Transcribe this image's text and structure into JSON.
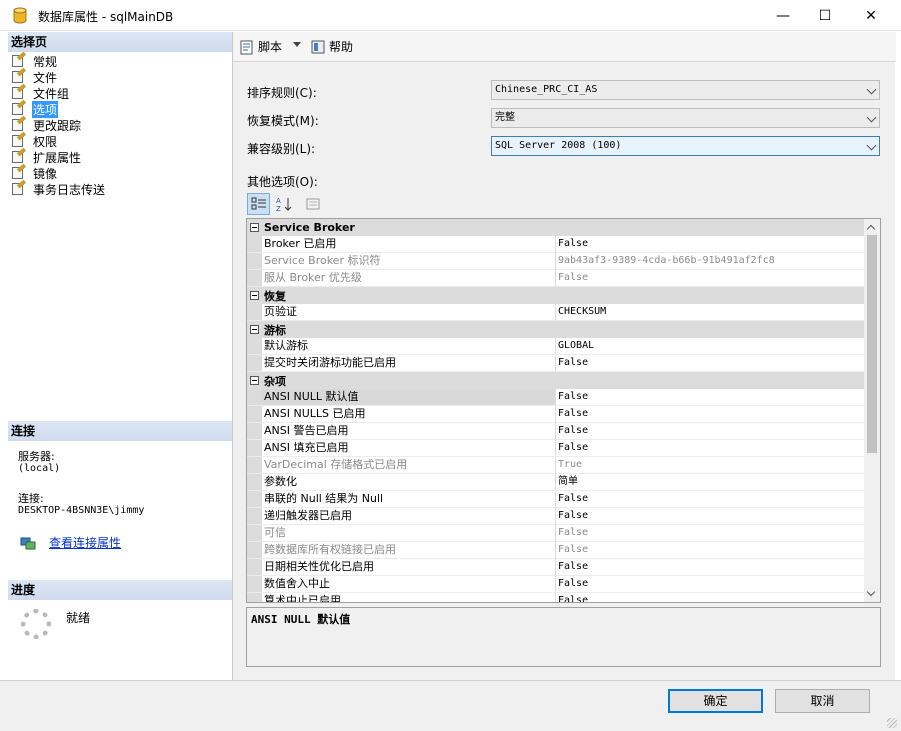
{
  "window": {
    "title": "数据库属性 - sqlMainDB",
    "icon": "database-cylinder-icon",
    "controls": {
      "minimize": "—",
      "maximize": "☐",
      "close": "✕"
    }
  },
  "left": {
    "select_page_header": "选择页",
    "pages": [
      {
        "label": "常规",
        "selected": false
      },
      {
        "label": "文件",
        "selected": false
      },
      {
        "label": "文件组",
        "selected": false
      },
      {
        "label": "选项",
        "selected": true
      },
      {
        "label": "更改跟踪",
        "selected": false
      },
      {
        "label": "权限",
        "selected": false
      },
      {
        "label": "扩展属性",
        "selected": false
      },
      {
        "label": "镜像",
        "selected": false
      },
      {
        "label": "事务日志传送",
        "selected": false
      }
    ],
    "connection_header": "连接",
    "server_label": "服务器:",
    "server_value": "(local)",
    "connection_label": "连接:",
    "connection_value": "DESKTOP-4BSNN3E\\jimmy",
    "view_connection_link": "查看连接属性",
    "progress_header": "进度",
    "progress_status": "就绪"
  },
  "toolbar": {
    "script_label": "脚本",
    "help_label": "帮助"
  },
  "form": {
    "collation_label": "排序规则(C):",
    "collation_value": "Chinese_PRC_CI_AS",
    "recovery_label": "恢复模式(M):",
    "recovery_value": "完整",
    "compat_label": "兼容级别(L):",
    "compat_value": "SQL Server 2008 (100)",
    "other_options_label": "其他选项(O):"
  },
  "grid": {
    "categories": [
      {
        "name": "Service Broker",
        "rows": [
          {
            "name": "Broker 已启用",
            "value": "False",
            "dim": false
          },
          {
            "name": "Service Broker 标识符",
            "value": "9ab43af3-9389-4cda-b66b-91b491af2fc8",
            "dim": true
          },
          {
            "name": "服从 Broker 优先级",
            "value": "False",
            "dim": true
          }
        ]
      },
      {
        "name": "恢复",
        "rows": [
          {
            "name": "页验证",
            "value": "CHECKSUM",
            "dim": false
          }
        ]
      },
      {
        "name": "游标",
        "rows": [
          {
            "name": "默认游标",
            "value": "GLOBAL",
            "dim": false
          },
          {
            "name": "提交时关闭游标功能已启用",
            "value": "False",
            "dim": false
          }
        ]
      },
      {
        "name": "杂项",
        "rows": [
          {
            "name": "ANSI NULL 默认值",
            "value": "False",
            "dim": false,
            "selected": true
          },
          {
            "name": "ANSI NULLS 已启用",
            "value": "False",
            "dim": false
          },
          {
            "name": "ANSI 警告已启用",
            "value": "False",
            "dim": false
          },
          {
            "name": "ANSI 填充已启用",
            "value": "False",
            "dim": false
          },
          {
            "name": "VarDecimal 存储格式已启用",
            "value": "True",
            "dim": true
          },
          {
            "name": "参数化",
            "value": "简单",
            "dim": false
          },
          {
            "name": "串联的 Null 结果为 Null",
            "value": "False",
            "dim": false
          },
          {
            "name": "递归触发器已启用",
            "value": "False",
            "dim": false
          },
          {
            "name": "可信",
            "value": "False",
            "dim": true
          },
          {
            "name": "跨数据库所有权链接已启用",
            "value": "False",
            "dim": true
          },
          {
            "name": "日期相关性优化已启用",
            "value": "False",
            "dim": false
          },
          {
            "name": "数值舍入中止",
            "value": "False",
            "dim": false
          },
          {
            "name": "算术中止已启用",
            "value": "False",
            "dim": false
          }
        ]
      }
    ],
    "description": "ANSI NULL 默认值"
  },
  "buttons": {
    "ok": "确定",
    "cancel": "取消"
  }
}
